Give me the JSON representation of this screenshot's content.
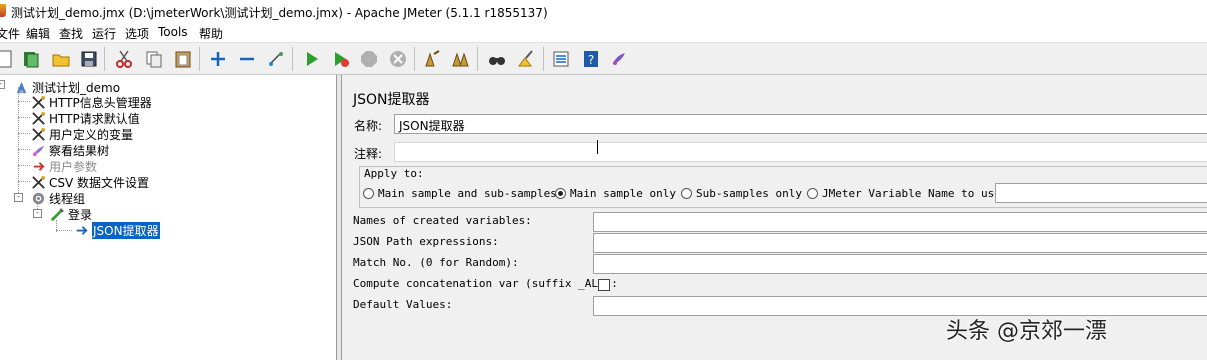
{
  "window": {
    "title": "测试计划_demo.jmx (D:\\jmeterWork\\测试计划_demo.jmx) - Apache JMeter (5.1.1 r1855137)"
  },
  "menu": [
    "文件",
    "编辑",
    "查找",
    "运行",
    "选项",
    "Tools",
    "帮助"
  ],
  "toolbar": {
    "icons": [
      "new-icon",
      "templates-icon",
      "open-icon",
      "save-icon",
      "cut-icon",
      "copy-icon",
      "paste-icon",
      "expand-icon",
      "collapse-icon",
      "toggle-icon",
      "start-icon",
      "start-no-pause-icon",
      "stop-icon",
      "shutdown-icon",
      "clear-icon",
      "clear-all-icon",
      "search-icon",
      "reset-search-icon",
      "function-helper-icon",
      "help-icon",
      "log-viewer-icon"
    ]
  },
  "tree": {
    "root": "测试计划_demo",
    "items": [
      {
        "label": "HTTP信息头管理器",
        "icon": "wrench-icon"
      },
      {
        "label": "HTTP请求默认值",
        "icon": "wrench-icon"
      },
      {
        "label": "用户定义的变量",
        "icon": "wrench-icon"
      },
      {
        "label": "察看结果树",
        "icon": "listener-icon"
      },
      {
        "label": "用户参数",
        "icon": "preprocessor-icon",
        "disabled": true
      },
      {
        "label": "CSV 数据文件设置",
        "icon": "wrench-icon"
      },
      {
        "label": "线程组",
        "icon": "gear-icon"
      },
      {
        "label": "登录",
        "icon": "sampler-icon"
      },
      {
        "label": "JSON提取器",
        "icon": "postprocessor-icon",
        "selected": true
      }
    ]
  },
  "panel": {
    "title": "JSON提取器",
    "name_label": "名称:",
    "name_value": "JSON提取器",
    "comment_label": "注释:",
    "apply_to": {
      "legend": "Apply to:",
      "options": [
        {
          "label": "Main sample and sub-samples",
          "checked": false
        },
        {
          "label": "Main sample only",
          "checked": true
        },
        {
          "label": "Sub-samples only",
          "checked": false
        },
        {
          "label": "JMeter Variable Name to use",
          "checked": false
        }
      ]
    },
    "fields": {
      "names_label": "Names of created variables:",
      "paths_label": "JSON Path expressions:",
      "match_label": "Match No. (0 for Random):",
      "concat_label": "Compute concatenation var (suffix _ALL):",
      "default_label": "Default Values:"
    }
  },
  "watermark": "头条 @京郊一漂"
}
